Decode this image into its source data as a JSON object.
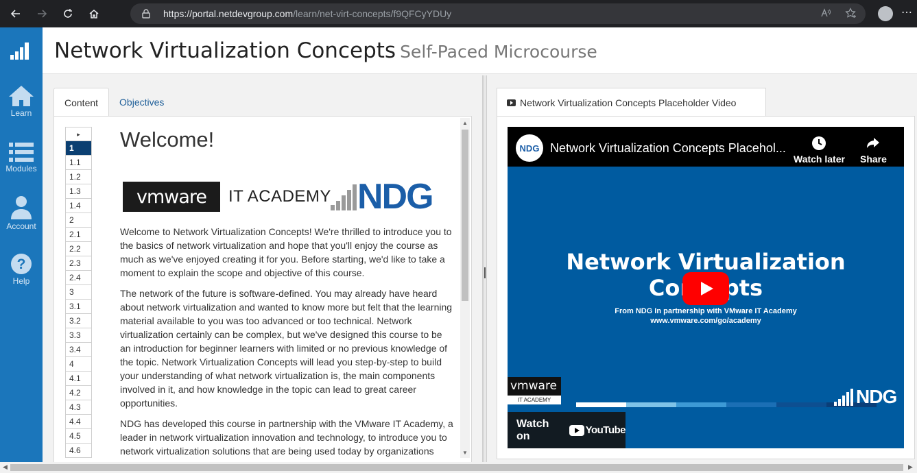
{
  "browser": {
    "url_host": "https://portal.netdevgroup.com",
    "url_path": "/learn/net-virt-concepts/f9QFCyYDUy",
    "icons": [
      "back-icon",
      "forward-icon",
      "reload-icon",
      "home-icon",
      "lock-icon",
      "read-aloud-icon",
      "favorites-icon",
      "profile-icon"
    ]
  },
  "sidebar": {
    "items": [
      {
        "label": "Learn",
        "icon": "home-icon"
      },
      {
        "label": "Modules",
        "icon": "list-icon"
      },
      {
        "label": "Account",
        "icon": "person-icon"
      },
      {
        "label": "Help",
        "icon": "help-icon"
      }
    ]
  },
  "header": {
    "title": "Network Virtualization Concepts",
    "subtitle": "Self-Paced Microcourse"
  },
  "left_panel": {
    "tabs": [
      {
        "label": "Content",
        "active": true
      },
      {
        "label": "Objectives",
        "active": false
      }
    ],
    "toc": {
      "toggle": "▸",
      "items": [
        "1",
        "1.1",
        "1.2",
        "1.3",
        "1.4",
        "2",
        "2.1",
        "2.2",
        "2.3",
        "2.4",
        "3",
        "3.1",
        "3.2",
        "3.3",
        "3.4",
        "4",
        "4.1",
        "4.2",
        "4.3",
        "4.4",
        "4.5",
        "4.6"
      ],
      "active": "1"
    },
    "article": {
      "heading": "Welcome!",
      "logo_vmware": "vmware",
      "logo_itacademy": "IT ACADEMY",
      "logo_ndg": "NDG",
      "paragraphs": [
        "Welcome to Network Virtualization Concepts! We're thrilled to introduce you to the basics of network virtualization and hope that you'll enjoy the course as much as we've enjoyed creating it for you. Before starting, we'd like to take a moment to explain the scope and objective of this course.",
        "The network of the future is software-defined. You may already have heard about network virtualization and wanted to know more but felt that the learning material available to you was too advanced or too technical. Network virtualization certainly can be complex, but we've designed this course to be an introduction for beginner learners with limited or no previous knowledge of the topic. Network Virtualization Concepts will lead you step-by-step to build your understanding of what network virtualization is, the main components involved in it, and how knowledge in the topic can lead to great career opportunities.",
        "NDG has developed this course in partnership with the VMware IT Academy, a leader in network virtualization innovation and technology, to introduce you to network virtualization solutions that are being used today by organizations"
      ]
    }
  },
  "right_panel": {
    "tab_label": "Network Virtualization Concepts Placeholder Video",
    "video": {
      "channel_logo": "NDG",
      "title": "Network Virtualization Concepts Placehol...",
      "watch_later": "Watch later",
      "share": "Share",
      "big_title": "Network Virtualization Concepts",
      "from_line": "From NDG In partnership with VMware IT Academy",
      "url_line": "www.vmware.com/go/academy",
      "vmware_badge": "vmware",
      "itacademy_badge": "IT ACADEMY",
      "ndg_badge": "NDG",
      "watch_on": "Watch on",
      "youtube": "YouTube",
      "stripe_colors": [
        "#ffffff",
        "#7fc3e8",
        "#3d9ad6",
        "#1b6fb5",
        "#0d4f91",
        "#0a3e78"
      ]
    }
  },
  "colors": {
    "sidebar": "#1b76bb",
    "toc_active": "#0b3f71",
    "ndg_blue": "#1b5ea8",
    "video_bg": "#005ba0",
    "play_red": "#ff0000"
  }
}
